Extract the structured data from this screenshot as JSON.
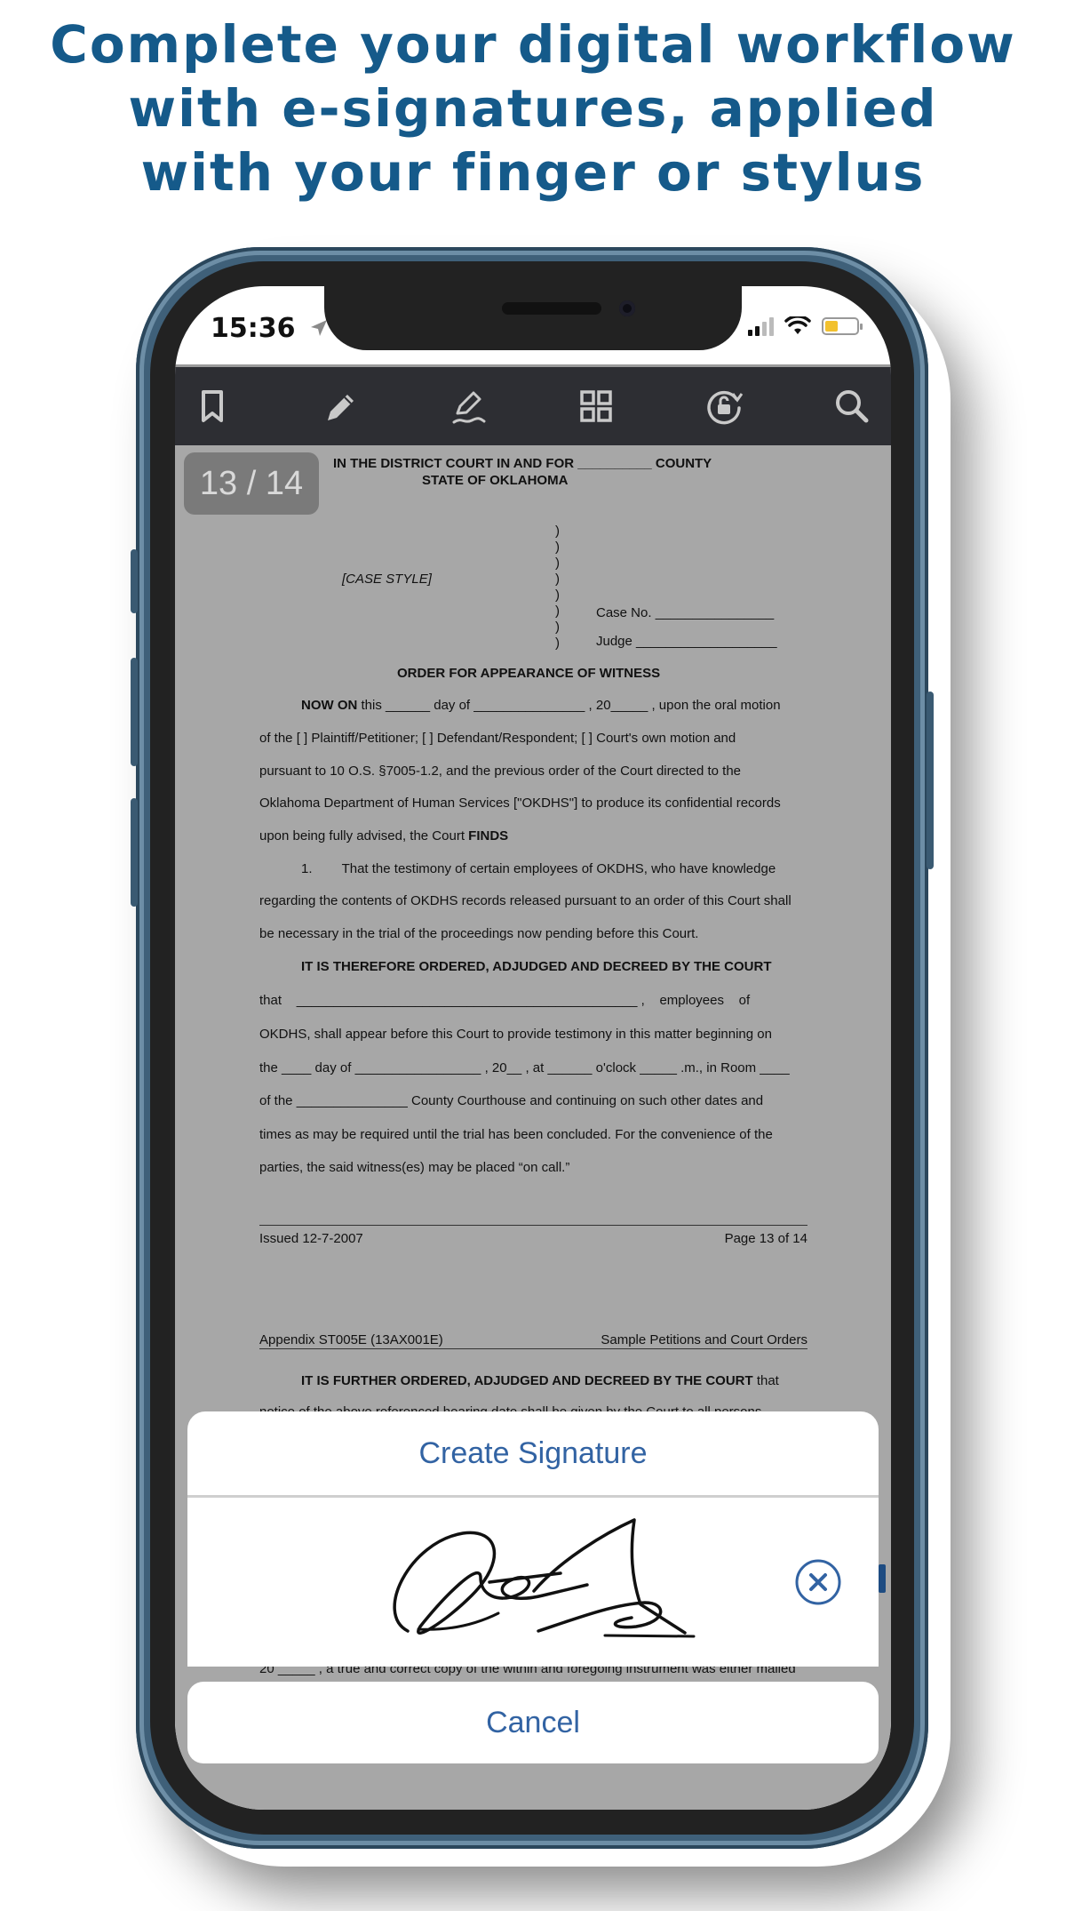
{
  "headline": [
    "Complete your digital workflow",
    "with e-signatures, applied",
    "with your finger or stylus"
  ],
  "status_bar": {
    "time": "15:36"
  },
  "toolbar": {
    "icons": [
      "bookmark-icon",
      "pencil-icon",
      "signature-pen-icon",
      "grid-icon",
      "rotate-lock-icon",
      "search-icon"
    ]
  },
  "page_indicator": "13 / 14",
  "document": {
    "court_header_1": "IN THE DISTRICT COURT IN AND FOR __________ COUNTY",
    "court_header_2": "STATE OF OKLAHOMA",
    "case_style": "[CASE STYLE]",
    "case_no": "Case No. ________________",
    "judge": "Judge ___________________",
    "title": "ORDER FOR APPEARANCE OF WITNESS",
    "now_on_bold": "NOW ON",
    "p1_l1": "this ______ day of _______________ , 20_____ , upon the oral motion",
    "p1_l2": "of the [    ] Plaintiff/Petitioner; [    ] Defendant/Respondent; [    ] Court's own motion and",
    "p1_l3": "pursuant to 10 O.S. §7005-1.2, and the previous order of the Court directed to the",
    "p1_l4": "Oklahoma Department of Human Services [\"OKDHS\"] to produce its confidential records",
    "p1_l5": "upon being fully advised, the Court",
    "finds": "FINDS",
    "p2_l1": "1.        That the testimony of certain employees of OKDHS, who have knowledge",
    "p2_l2": "regarding the contents of OKDHS records released pursuant to an order of this Court shall",
    "p2_l3": "be necessary in the trial of the proceedings now pending before this Court.",
    "ordered": "IT IS THEREFORE ORDERED, ADJUDGED AND DECREED BY THE COURT",
    "p3_l1": "that    ______________________________________________ ,    employees    of",
    "p3_l2": "OKDHS, shall appear before this Court to provide testimony in this matter beginning on",
    "p3_l3": "the ____ day of _________________ , 20__ , at ______ o'clock _____ .m., in Room ____",
    "p3_l4": "of the _______________ County Courthouse and continuing on such other dates and",
    "p3_l5": "times as may be required until the trial has been concluded. For the convenience of the",
    "p3_l6": "parties, the said witness(es) may be placed “on call.”",
    "footer_left": "Issued 12-7-2007",
    "footer_right": "Page 13 of 14",
    "appendix_left": "Appendix ST005E (13AX001E)",
    "appendix_right": "Sample Petitions and Court Orders",
    "further_ordered": "IT IS FURTHER ORDERED, ADJUDGED AND DECREED BY THE COURT",
    "further_that": "that",
    "partial_line": "notice of the above referenced hearing date shall be given by the Court to all persons",
    "bottom_line": "20 _____ , a true and correct copy of the within and foregoing instrument was either mailed"
  },
  "signature_sheet": {
    "title": "Create Signature",
    "cancel": "Cancel",
    "clear_icon": "close-circle-icon"
  }
}
